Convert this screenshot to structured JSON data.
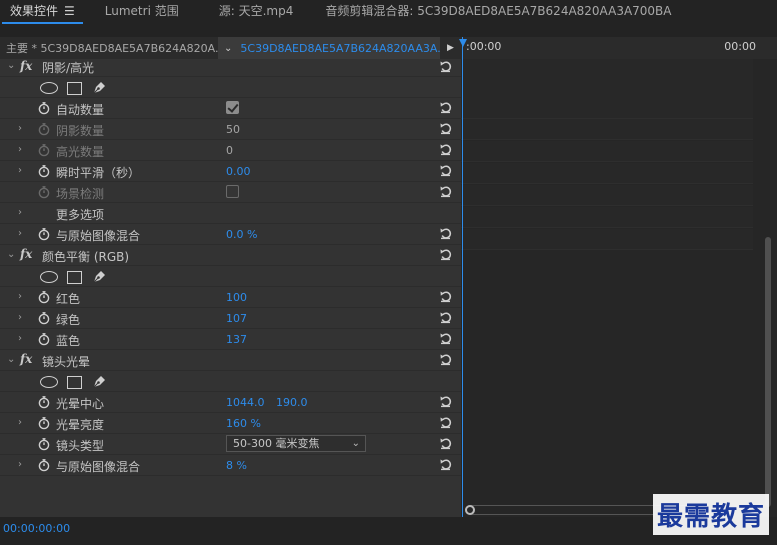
{
  "tabs": [
    {
      "label": "效果控件",
      "active": true
    },
    {
      "label": "Lumetri 范围",
      "active": false
    },
    {
      "label": "源: 天空.mp4",
      "active": false
    },
    {
      "label": "音频剪辑混合器: 5C39D8AED8AE5A7B624A820AA3A700BA",
      "active": false
    }
  ],
  "clip": {
    "master": "主要 * 5C39D8AED8AE5A7B624A820A...",
    "sequence": "5C39D8AED8AE5A7B624A820AA3A..."
  },
  "timeline": {
    "start": ":00:00",
    "end": "00:00"
  },
  "sections": {
    "shadow_highlight": {
      "title": "阴影/高光",
      "auto_amount": {
        "label": "自动数量",
        "checked": true
      },
      "shadow_amount": {
        "label": "阴影数量",
        "value": "50"
      },
      "highlight_amount": {
        "label": "高光数量",
        "value": "0"
      },
      "temporal_smoothing": {
        "label": "瞬时平滑（秒）",
        "value": "0.00"
      },
      "scene_detect": {
        "label": "场景检测",
        "checked": false
      },
      "more_options": {
        "label": "更多选项"
      },
      "blend": {
        "label": "与原始图像混合",
        "value": "0.0 %"
      }
    },
    "color_balance": {
      "title": "颜色平衡 (RGB)",
      "red": {
        "label": "红色",
        "value": "100"
      },
      "green": {
        "label": "绿色",
        "value": "107"
      },
      "blue": {
        "label": "蓝色",
        "value": "137"
      }
    },
    "lens_flare": {
      "title": "镜头光晕",
      "center": {
        "label": "光晕中心",
        "x": "1044.0",
        "y": "190.0"
      },
      "brightness": {
        "label": "光晕亮度",
        "value": "160 %"
      },
      "lens_type": {
        "label": "镜头类型",
        "value": "50-300 毫米变焦"
      },
      "blend": {
        "label": "与原始图像混合",
        "value": "8 %"
      }
    }
  },
  "footer": {
    "timecode": "00:00:00:00"
  },
  "watermark": "最需教育",
  "colors": {
    "accent": "#2d8ceb",
    "panel": "#333333",
    "background": "#232323"
  }
}
